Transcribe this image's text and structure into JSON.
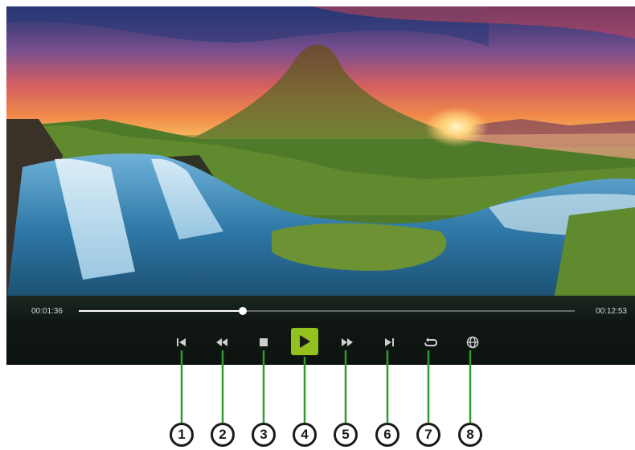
{
  "player": {
    "elapsed_time": "00:01:36",
    "total_time": "00:12:53",
    "progress": 0.33
  },
  "controls": [
    {
      "icon": "skip-previous-icon",
      "active": false
    },
    {
      "icon": "rewind-icon",
      "active": false
    },
    {
      "icon": "stop-icon",
      "active": false
    },
    {
      "icon": "play-icon",
      "active": true
    },
    {
      "icon": "fast-forward-icon",
      "active": false
    },
    {
      "icon": "skip-next-icon",
      "active": false
    },
    {
      "icon": "repeat-icon",
      "active": false
    },
    {
      "icon": "globe-icon",
      "active": false
    }
  ],
  "callouts": [
    "1",
    "2",
    "3",
    "4",
    "5",
    "6",
    "7",
    "8"
  ],
  "colors": {
    "active_button": "#93c11d",
    "callout_line": "#2f9a2f",
    "icon": "#cfcfcf"
  }
}
